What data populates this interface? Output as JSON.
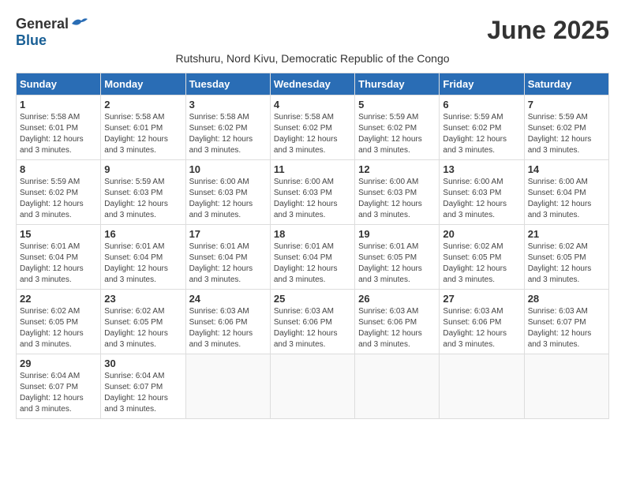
{
  "logo": {
    "general": "General",
    "blue": "Blue"
  },
  "title": "June 2025",
  "subtitle": "Rutshuru, Nord Kivu, Democratic Republic of the Congo",
  "headers": [
    "Sunday",
    "Monday",
    "Tuesday",
    "Wednesday",
    "Thursday",
    "Friday",
    "Saturday"
  ],
  "weeks": [
    [
      {
        "day": "1",
        "info": "Sunrise: 5:58 AM\nSunset: 6:01 PM\nDaylight: 12 hours\nand 3 minutes."
      },
      {
        "day": "2",
        "info": "Sunrise: 5:58 AM\nSunset: 6:01 PM\nDaylight: 12 hours\nand 3 minutes."
      },
      {
        "day": "3",
        "info": "Sunrise: 5:58 AM\nSunset: 6:02 PM\nDaylight: 12 hours\nand 3 minutes."
      },
      {
        "day": "4",
        "info": "Sunrise: 5:58 AM\nSunset: 6:02 PM\nDaylight: 12 hours\nand 3 minutes."
      },
      {
        "day": "5",
        "info": "Sunrise: 5:59 AM\nSunset: 6:02 PM\nDaylight: 12 hours\nand 3 minutes."
      },
      {
        "day": "6",
        "info": "Sunrise: 5:59 AM\nSunset: 6:02 PM\nDaylight: 12 hours\nand 3 minutes."
      },
      {
        "day": "7",
        "info": "Sunrise: 5:59 AM\nSunset: 6:02 PM\nDaylight: 12 hours\nand 3 minutes."
      }
    ],
    [
      {
        "day": "8",
        "info": "Sunrise: 5:59 AM\nSunset: 6:02 PM\nDaylight: 12 hours\nand 3 minutes."
      },
      {
        "day": "9",
        "info": "Sunrise: 5:59 AM\nSunset: 6:03 PM\nDaylight: 12 hours\nand 3 minutes."
      },
      {
        "day": "10",
        "info": "Sunrise: 6:00 AM\nSunset: 6:03 PM\nDaylight: 12 hours\nand 3 minutes."
      },
      {
        "day": "11",
        "info": "Sunrise: 6:00 AM\nSunset: 6:03 PM\nDaylight: 12 hours\nand 3 minutes."
      },
      {
        "day": "12",
        "info": "Sunrise: 6:00 AM\nSunset: 6:03 PM\nDaylight: 12 hours\nand 3 minutes."
      },
      {
        "day": "13",
        "info": "Sunrise: 6:00 AM\nSunset: 6:03 PM\nDaylight: 12 hours\nand 3 minutes."
      },
      {
        "day": "14",
        "info": "Sunrise: 6:00 AM\nSunset: 6:04 PM\nDaylight: 12 hours\nand 3 minutes."
      }
    ],
    [
      {
        "day": "15",
        "info": "Sunrise: 6:01 AM\nSunset: 6:04 PM\nDaylight: 12 hours\nand 3 minutes."
      },
      {
        "day": "16",
        "info": "Sunrise: 6:01 AM\nSunset: 6:04 PM\nDaylight: 12 hours\nand 3 minutes."
      },
      {
        "day": "17",
        "info": "Sunrise: 6:01 AM\nSunset: 6:04 PM\nDaylight: 12 hours\nand 3 minutes."
      },
      {
        "day": "18",
        "info": "Sunrise: 6:01 AM\nSunset: 6:04 PM\nDaylight: 12 hours\nand 3 minutes."
      },
      {
        "day": "19",
        "info": "Sunrise: 6:01 AM\nSunset: 6:05 PM\nDaylight: 12 hours\nand 3 minutes."
      },
      {
        "day": "20",
        "info": "Sunrise: 6:02 AM\nSunset: 6:05 PM\nDaylight: 12 hours\nand 3 minutes."
      },
      {
        "day": "21",
        "info": "Sunrise: 6:02 AM\nSunset: 6:05 PM\nDaylight: 12 hours\nand 3 minutes."
      }
    ],
    [
      {
        "day": "22",
        "info": "Sunrise: 6:02 AM\nSunset: 6:05 PM\nDaylight: 12 hours\nand 3 minutes."
      },
      {
        "day": "23",
        "info": "Sunrise: 6:02 AM\nSunset: 6:05 PM\nDaylight: 12 hours\nand 3 minutes."
      },
      {
        "day": "24",
        "info": "Sunrise: 6:03 AM\nSunset: 6:06 PM\nDaylight: 12 hours\nand 3 minutes."
      },
      {
        "day": "25",
        "info": "Sunrise: 6:03 AM\nSunset: 6:06 PM\nDaylight: 12 hours\nand 3 minutes."
      },
      {
        "day": "26",
        "info": "Sunrise: 6:03 AM\nSunset: 6:06 PM\nDaylight: 12 hours\nand 3 minutes."
      },
      {
        "day": "27",
        "info": "Sunrise: 6:03 AM\nSunset: 6:06 PM\nDaylight: 12 hours\nand 3 minutes."
      },
      {
        "day": "28",
        "info": "Sunrise: 6:03 AM\nSunset: 6:07 PM\nDaylight: 12 hours\nand 3 minutes."
      }
    ],
    [
      {
        "day": "29",
        "info": "Sunrise: 6:04 AM\nSunset: 6:07 PM\nDaylight: 12 hours\nand 3 minutes."
      },
      {
        "day": "30",
        "info": "Sunrise: 6:04 AM\nSunset: 6:07 PM\nDaylight: 12 hours\nand 3 minutes."
      },
      {
        "day": "",
        "info": ""
      },
      {
        "day": "",
        "info": ""
      },
      {
        "day": "",
        "info": ""
      },
      {
        "day": "",
        "info": ""
      },
      {
        "day": "",
        "info": ""
      }
    ]
  ]
}
